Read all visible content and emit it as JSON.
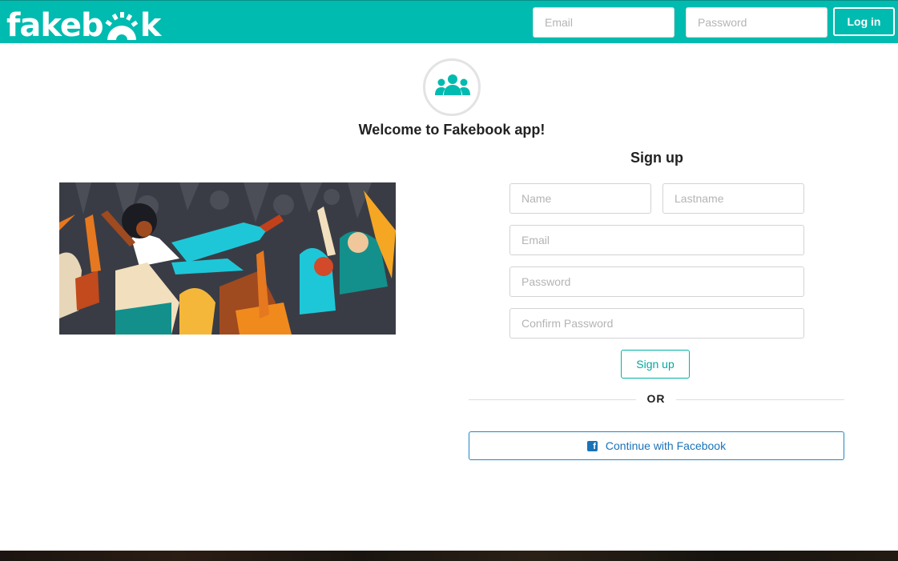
{
  "header": {
    "logo_text": "fakebook",
    "email_placeholder": "Email",
    "password_placeholder": "Password",
    "login_label": "Log in",
    "brand_color": "#00bbb0"
  },
  "welcome": {
    "icon": "users-group-icon",
    "title": "Welcome to Fakebook app!"
  },
  "illustration": {
    "description_icon": "crowd-surfing-illustration"
  },
  "signup": {
    "title": "Sign up",
    "name_placeholder": "Name",
    "lastname_placeholder": "Lastname",
    "email_placeholder": "Email",
    "password_placeholder": "Password",
    "confirm_placeholder": "Confirm Password",
    "button_label": "Sign up",
    "or_label": "OR",
    "facebook_label": "Continue with Facebook",
    "facebook_icon": "facebook-icon",
    "facebook_color": "#1a73b8"
  }
}
